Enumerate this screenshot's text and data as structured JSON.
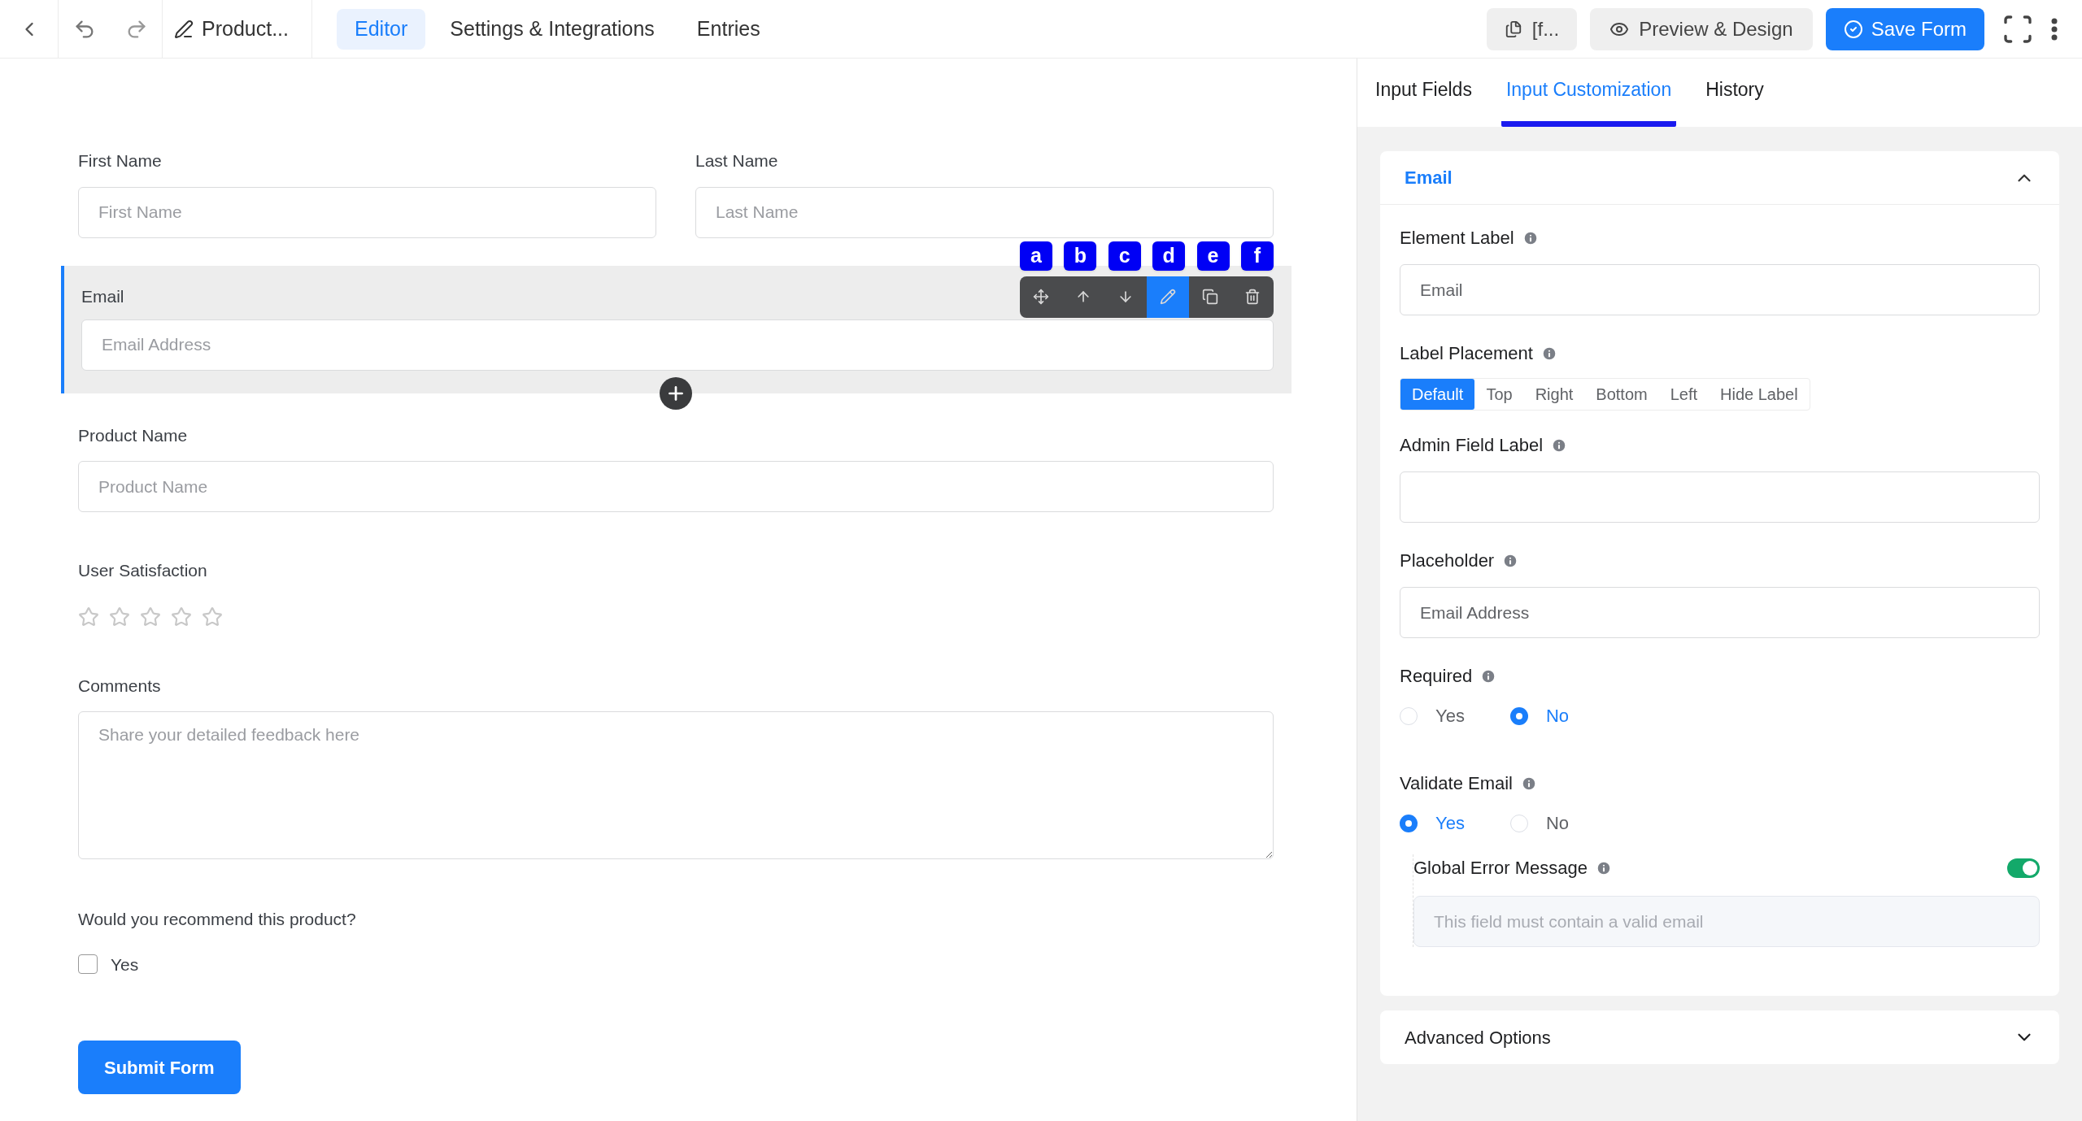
{
  "top_bar": {
    "title": "Product...",
    "tabs": [
      {
        "label": "Editor",
        "selected": true
      },
      {
        "label": "Settings & Integrations",
        "selected": false
      },
      {
        "label": "Entries",
        "selected": false
      }
    ],
    "shortcode_button": "[f...",
    "preview_button": "Preview & Design",
    "save_button": "Save Form"
  },
  "form": {
    "first_name": {
      "label": "First Name",
      "placeholder": "First Name"
    },
    "last_name": {
      "label": "Last Name",
      "placeholder": "Last Name"
    },
    "email": {
      "label": "Email",
      "placeholder": "Email Address",
      "selected": true
    },
    "field_toolbar": {
      "badges": [
        "a",
        "b",
        "c",
        "d",
        "e",
        "f"
      ],
      "actions": [
        {
          "kind": "move",
          "selected": false
        },
        {
          "kind": "up",
          "selected": false
        },
        {
          "kind": "down",
          "selected": false
        },
        {
          "kind": "edit",
          "selected": true
        },
        {
          "kind": "copy",
          "selected": false
        },
        {
          "kind": "delete",
          "selected": false
        }
      ]
    },
    "product_name": {
      "label": "Product Name",
      "placeholder": "Product Name"
    },
    "user_satisfaction": {
      "label": "User Satisfaction",
      "stars": 0
    },
    "comments": {
      "label": "Comments",
      "placeholder": "Share your detailed feedback here"
    },
    "recommend": {
      "label": "Would you recommend this product?",
      "option": "Yes",
      "checked": false
    },
    "submit_button": "Submit Form"
  },
  "settings_panel": {
    "tabs": [
      {
        "label": "Input Fields",
        "selected": false
      },
      {
        "label": "Input Customization",
        "selected": true
      },
      {
        "label": "History",
        "selected": false
      }
    ],
    "section": {
      "title": "Email",
      "expanded": true,
      "element_label": {
        "label": "Element Label",
        "value": "Email"
      },
      "label_placement": {
        "label": "Label Placement",
        "options": [
          {
            "label": "Default",
            "selected": true
          },
          {
            "label": "Top",
            "selected": false
          },
          {
            "label": "Right",
            "selected": false
          },
          {
            "label": "Bottom",
            "selected": false
          },
          {
            "label": "Left",
            "selected": false
          },
          {
            "label": "Hide Label",
            "selected": false
          }
        ]
      },
      "admin_field_label": {
        "label": "Admin Field Label"
      },
      "placeholder": {
        "label": "Placeholder",
        "value": "Email Address"
      },
      "required": {
        "label": "Required",
        "options": [
          {
            "label": "Yes",
            "selected": false
          },
          {
            "label": "No",
            "selected": true
          }
        ]
      },
      "validate_email": {
        "label": "Validate Email",
        "options": [
          {
            "label": "Yes",
            "selected": true
          },
          {
            "label": "No",
            "selected": false
          }
        ]
      },
      "global_error_message": {
        "label": "Global Error Message",
        "on": true,
        "placeholder": "This field must contain a valid email"
      }
    },
    "advanced_options": {
      "title": "Advanced Options",
      "expanded": false
    }
  }
}
